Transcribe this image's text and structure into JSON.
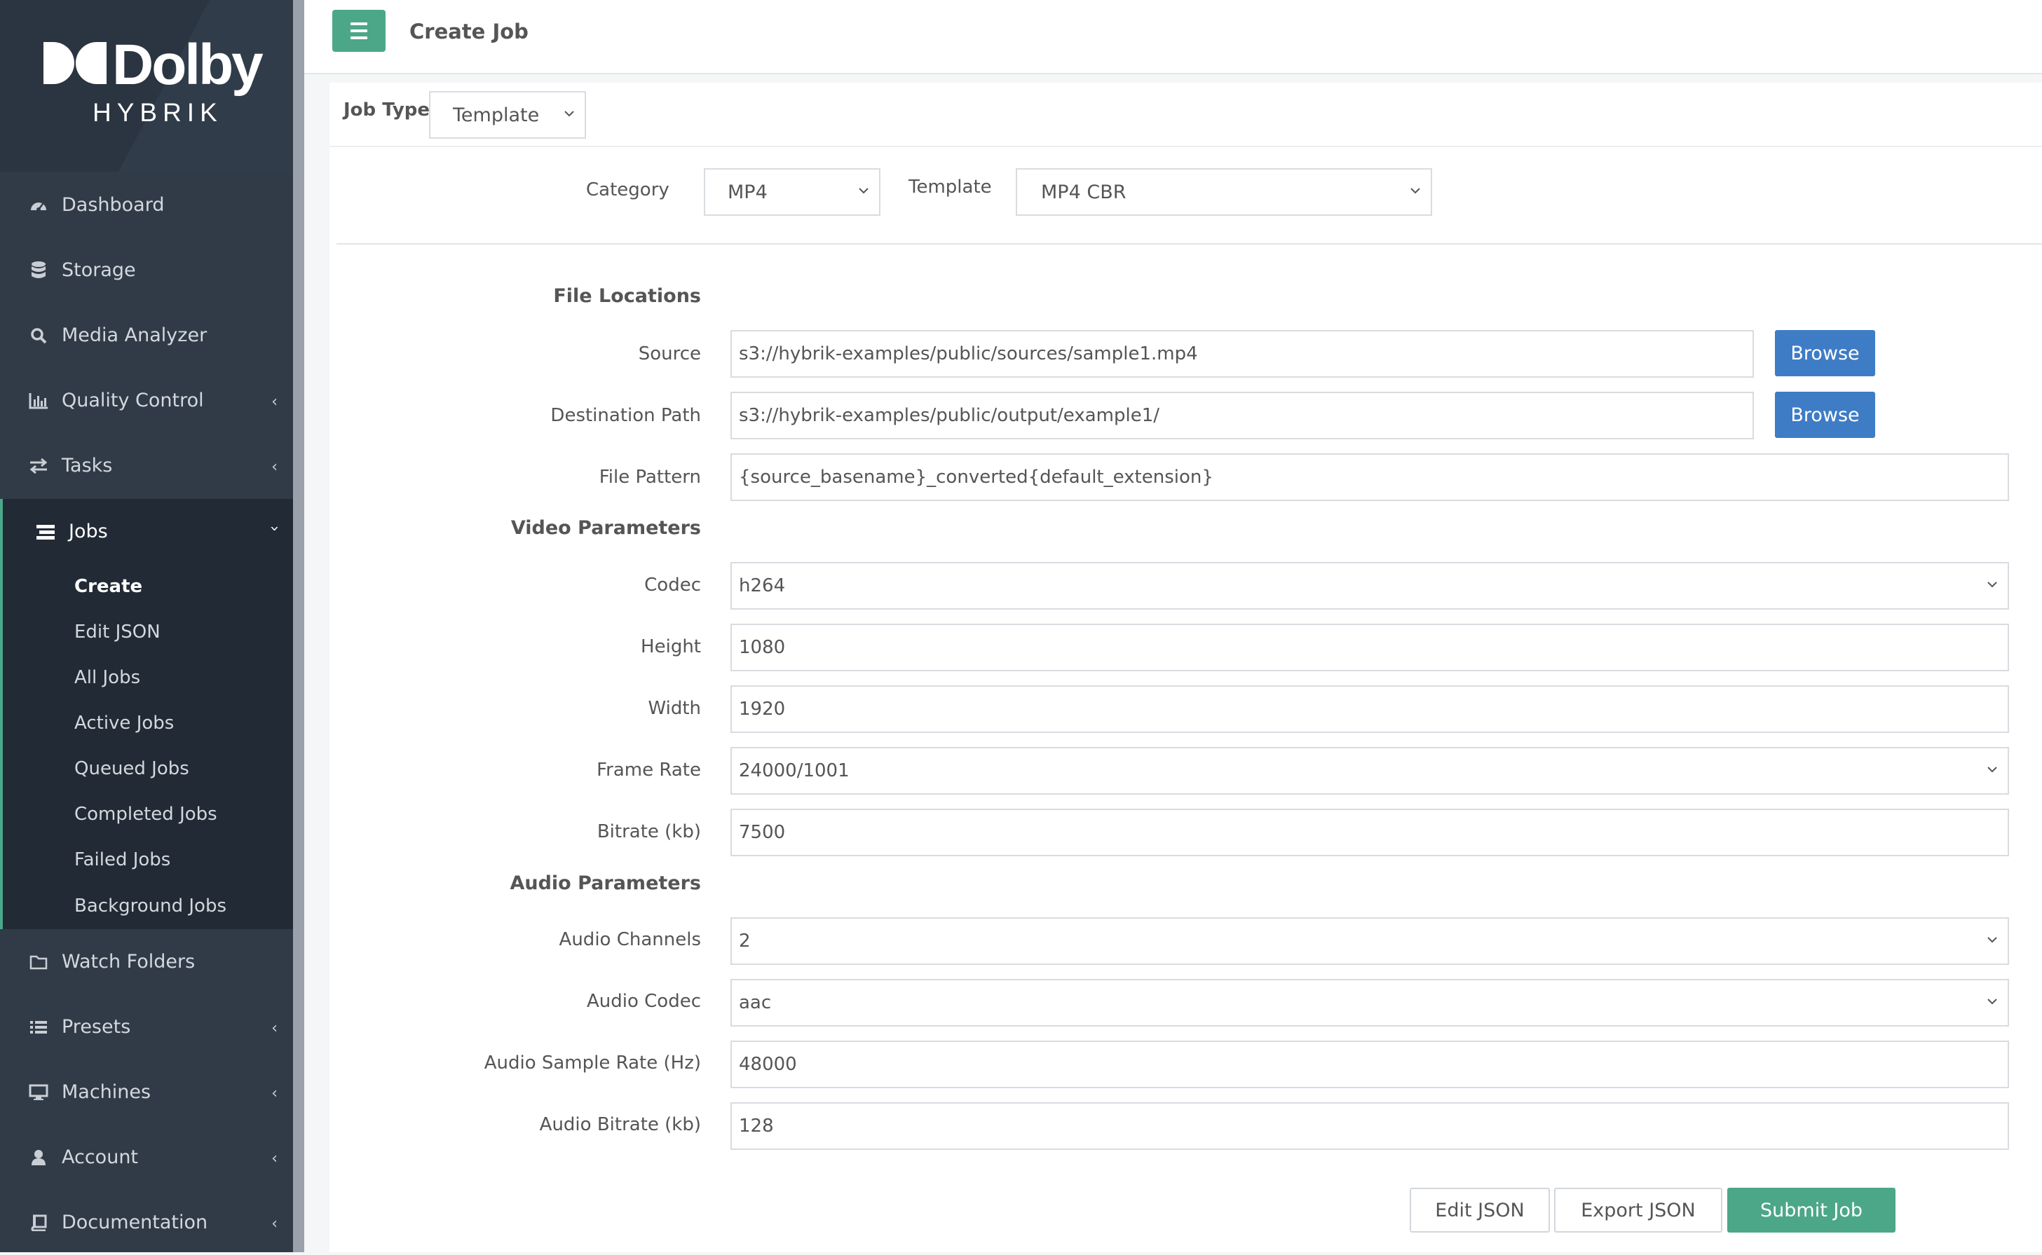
{
  "brand": {
    "name": "Dolby",
    "product": "HYBRIK"
  },
  "colors": {
    "accent": "#4ca789",
    "browse": "#3e7cc6",
    "sidebar": "#313b48"
  },
  "sidebar": {
    "items": [
      {
        "label": "Dashboard",
        "icon": "dashboard-icon"
      },
      {
        "label": "Storage",
        "icon": "database-icon"
      },
      {
        "label": "Media Analyzer",
        "icon": "search-icon"
      },
      {
        "label": "Quality Control",
        "icon": "bar-chart-icon"
      },
      {
        "label": "Tasks",
        "icon": "exchange-icon"
      },
      {
        "label": "Jobs",
        "icon": "tasks-list-icon"
      },
      {
        "label": "Watch Folders",
        "icon": "folder-icon"
      },
      {
        "label": "Presets",
        "icon": "list-icon"
      },
      {
        "label": "Machines",
        "icon": "desktop-icon"
      },
      {
        "label": "Account",
        "icon": "user-icon"
      },
      {
        "label": "Documentation",
        "icon": "book-icon"
      }
    ],
    "jobs_sub": [
      "Create",
      "Edit JSON",
      "All Jobs",
      "Active Jobs",
      "Queued Jobs",
      "Completed Jobs",
      "Failed Jobs",
      "Background Jobs"
    ]
  },
  "header": {
    "title": "Create Job"
  },
  "form": {
    "job_type": {
      "label": "Job Type",
      "value": "Template"
    },
    "category": {
      "label": "Category",
      "value": "MP4"
    },
    "template": {
      "label": "Template",
      "value": "MP4 CBR"
    },
    "sections": {
      "file_locations": "File Locations",
      "video": "Video Parameters",
      "audio": "Audio Parameters"
    },
    "source": {
      "label": "Source",
      "value": "s3://hybrik-examples/public/sources/sample1.mp4"
    },
    "destination": {
      "label": "Destination Path",
      "value": "s3://hybrik-examples/public/output/example1/"
    },
    "browse_label": "Browse",
    "file_pattern": {
      "label": "File Pattern",
      "value": "{source_basename}_converted{default_extension}"
    },
    "codec": {
      "label": "Codec",
      "value": "h264"
    },
    "height": {
      "label": "Height",
      "value": "1080"
    },
    "width": {
      "label": "Width",
      "value": "1920"
    },
    "frame_rate": {
      "label": "Frame Rate",
      "value": "24000/1001"
    },
    "bitrate": {
      "label": "Bitrate (kb)",
      "value": "7500"
    },
    "audio_channels": {
      "label": "Audio Channels",
      "value": "2"
    },
    "audio_codec": {
      "label": "Audio Codec",
      "value": "aac"
    },
    "audio_sample_rate": {
      "label": "Audio Sample Rate (Hz)",
      "value": "48000"
    },
    "audio_bitrate": {
      "label": "Audio Bitrate (kb)",
      "value": "128"
    }
  },
  "actions": {
    "edit_json": "Edit JSON",
    "export_json": "Export JSON",
    "submit": "Submit Job"
  }
}
